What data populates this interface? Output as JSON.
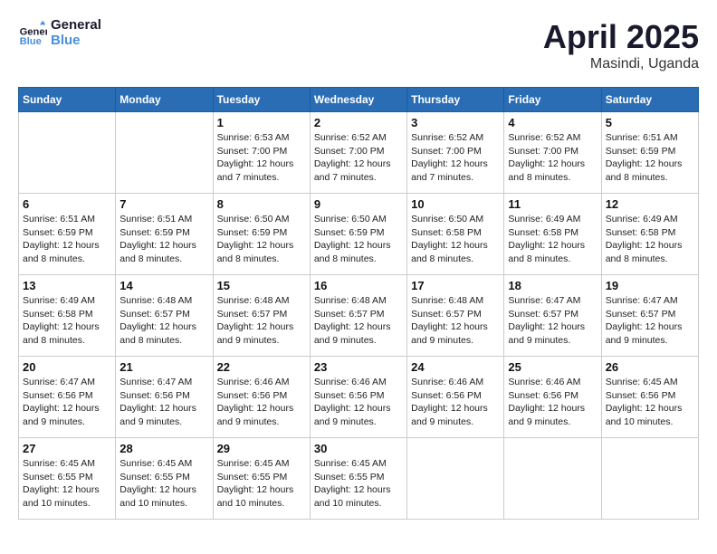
{
  "header": {
    "logo_line1": "General",
    "logo_line2": "Blue",
    "month": "April 2025",
    "location": "Masindi, Uganda"
  },
  "days_of_week": [
    "Sunday",
    "Monday",
    "Tuesday",
    "Wednesday",
    "Thursday",
    "Friday",
    "Saturday"
  ],
  "weeks": [
    [
      {
        "day": "",
        "info": ""
      },
      {
        "day": "",
        "info": ""
      },
      {
        "day": "1",
        "sunrise": "6:53 AM",
        "sunset": "7:00 PM",
        "daylight": "12 hours and 7 minutes."
      },
      {
        "day": "2",
        "sunrise": "6:52 AM",
        "sunset": "7:00 PM",
        "daylight": "12 hours and 7 minutes."
      },
      {
        "day": "3",
        "sunrise": "6:52 AM",
        "sunset": "7:00 PM",
        "daylight": "12 hours and 7 minutes."
      },
      {
        "day": "4",
        "sunrise": "6:52 AM",
        "sunset": "7:00 PM",
        "daylight": "12 hours and 8 minutes."
      },
      {
        "day": "5",
        "sunrise": "6:51 AM",
        "sunset": "6:59 PM",
        "daylight": "12 hours and 8 minutes."
      }
    ],
    [
      {
        "day": "6",
        "sunrise": "6:51 AM",
        "sunset": "6:59 PM",
        "daylight": "12 hours and 8 minutes."
      },
      {
        "day": "7",
        "sunrise": "6:51 AM",
        "sunset": "6:59 PM",
        "daylight": "12 hours and 8 minutes."
      },
      {
        "day": "8",
        "sunrise": "6:50 AM",
        "sunset": "6:59 PM",
        "daylight": "12 hours and 8 minutes."
      },
      {
        "day": "9",
        "sunrise": "6:50 AM",
        "sunset": "6:59 PM",
        "daylight": "12 hours and 8 minutes."
      },
      {
        "day": "10",
        "sunrise": "6:50 AM",
        "sunset": "6:58 PM",
        "daylight": "12 hours and 8 minutes."
      },
      {
        "day": "11",
        "sunrise": "6:49 AM",
        "sunset": "6:58 PM",
        "daylight": "12 hours and 8 minutes."
      },
      {
        "day": "12",
        "sunrise": "6:49 AM",
        "sunset": "6:58 PM",
        "daylight": "12 hours and 8 minutes."
      }
    ],
    [
      {
        "day": "13",
        "sunrise": "6:49 AM",
        "sunset": "6:58 PM",
        "daylight": "12 hours and 8 minutes."
      },
      {
        "day": "14",
        "sunrise": "6:48 AM",
        "sunset": "6:57 PM",
        "daylight": "12 hours and 8 minutes."
      },
      {
        "day": "15",
        "sunrise": "6:48 AM",
        "sunset": "6:57 PM",
        "daylight": "12 hours and 9 minutes."
      },
      {
        "day": "16",
        "sunrise": "6:48 AM",
        "sunset": "6:57 PM",
        "daylight": "12 hours and 9 minutes."
      },
      {
        "day": "17",
        "sunrise": "6:48 AM",
        "sunset": "6:57 PM",
        "daylight": "12 hours and 9 minutes."
      },
      {
        "day": "18",
        "sunrise": "6:47 AM",
        "sunset": "6:57 PM",
        "daylight": "12 hours and 9 minutes."
      },
      {
        "day": "19",
        "sunrise": "6:47 AM",
        "sunset": "6:57 PM",
        "daylight": "12 hours and 9 minutes."
      }
    ],
    [
      {
        "day": "20",
        "sunrise": "6:47 AM",
        "sunset": "6:56 PM",
        "daylight": "12 hours and 9 minutes."
      },
      {
        "day": "21",
        "sunrise": "6:47 AM",
        "sunset": "6:56 PM",
        "daylight": "12 hours and 9 minutes."
      },
      {
        "day": "22",
        "sunrise": "6:46 AM",
        "sunset": "6:56 PM",
        "daylight": "12 hours and 9 minutes."
      },
      {
        "day": "23",
        "sunrise": "6:46 AM",
        "sunset": "6:56 PM",
        "daylight": "12 hours and 9 minutes."
      },
      {
        "day": "24",
        "sunrise": "6:46 AM",
        "sunset": "6:56 PM",
        "daylight": "12 hours and 9 minutes."
      },
      {
        "day": "25",
        "sunrise": "6:46 AM",
        "sunset": "6:56 PM",
        "daylight": "12 hours and 9 minutes."
      },
      {
        "day": "26",
        "sunrise": "6:45 AM",
        "sunset": "6:56 PM",
        "daylight": "12 hours and 10 minutes."
      }
    ],
    [
      {
        "day": "27",
        "sunrise": "6:45 AM",
        "sunset": "6:55 PM",
        "daylight": "12 hours and 10 minutes."
      },
      {
        "day": "28",
        "sunrise": "6:45 AM",
        "sunset": "6:55 PM",
        "daylight": "12 hours and 10 minutes."
      },
      {
        "day": "29",
        "sunrise": "6:45 AM",
        "sunset": "6:55 PM",
        "daylight": "12 hours and 10 minutes."
      },
      {
        "day": "30",
        "sunrise": "6:45 AM",
        "sunset": "6:55 PM",
        "daylight": "12 hours and 10 minutes."
      },
      {
        "day": "",
        "info": ""
      },
      {
        "day": "",
        "info": ""
      },
      {
        "day": "",
        "info": ""
      }
    ]
  ]
}
